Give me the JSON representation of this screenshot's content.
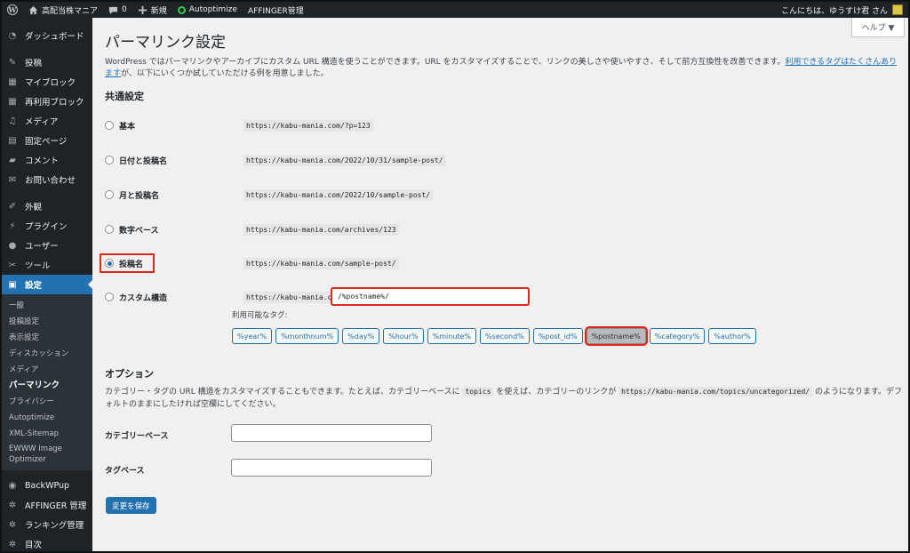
{
  "adminbar": {
    "site_name": "高配当株マニア",
    "comments_count": "0",
    "new_label": "新規",
    "autoptimize_label": "Autoptimize",
    "affinger_label": "AFFINGER管理",
    "greeting": "こんにちは、ゆうすけ君 さん",
    "status_color": "#2ecc40"
  },
  "sidebar": {
    "items": [
      {
        "label": "ダッシュボード",
        "icon": "dashboard-icon"
      },
      {
        "label": "投稿",
        "icon": "pin-icon"
      },
      {
        "label": "マイブロック",
        "icon": "grid-icon"
      },
      {
        "label": "再利用ブロック",
        "icon": "grid-icon"
      },
      {
        "label": "メディア",
        "icon": "media-icon"
      },
      {
        "label": "固定ページ",
        "icon": "page-icon"
      },
      {
        "label": "コメント",
        "icon": "comment-icon"
      },
      {
        "label": "お問い合わせ",
        "icon": "mail-icon"
      },
      {
        "label": "外観",
        "icon": "brush-icon"
      },
      {
        "label": "プラグイン",
        "icon": "plugin-icon"
      },
      {
        "label": "ユーザー",
        "icon": "user-icon"
      },
      {
        "label": "ツール",
        "icon": "wrench-icon"
      },
      {
        "label": "設定",
        "icon": "settings-icon"
      }
    ],
    "submenu": [
      "一般",
      "投稿設定",
      "表示設定",
      "ディスカッション",
      "メディア",
      "パーマリンク",
      "プライバシー",
      "Autoptimize",
      "XML-Sitemap",
      "EWWW Image Optimizer"
    ],
    "bottom_items": [
      {
        "label": "BackWPup",
        "icon": "backwpup-icon"
      },
      {
        "label": "AFFINGER 管理",
        "icon": "gear-icon"
      },
      {
        "label": "ランキング管理",
        "icon": "gear-icon"
      },
      {
        "label": "目次",
        "icon": "gear-icon"
      }
    ],
    "accent": "#2271b1"
  },
  "page": {
    "help_label": "ヘルプ ▼",
    "title": "パーマリンク設定",
    "intro_text": "WordPress ではパーマリンクやアーカイブにカスタム URL 構造を使うことができます。URL をカスタマイズすることで、リンクの美しさや使いやすさ、そして前方互換性を改善できます。",
    "intro_link": "利用できるタグはたくさんあります",
    "intro_tail": "が、以下にいくつか試していただける例を用意しました。",
    "common_heading": "共通設定",
    "options": [
      {
        "label": "基本",
        "example": "https://kabu-mania.com/?p=123",
        "checked": false
      },
      {
        "label": "日付と投稿名",
        "example": "https://kabu-mania.com/2022/10/31/sample-post/",
        "checked": false
      },
      {
        "label": "月と投稿名",
        "example": "https://kabu-mania.com/2022/10/sample-post/",
        "checked": false
      },
      {
        "label": "数字ベース",
        "example": "https://kabu-mania.com/archives/123",
        "checked": false
      },
      {
        "label": "投稿名",
        "example": "https://kabu-mania.com/sample-post/",
        "checked": true
      }
    ],
    "custom": {
      "label": "カスタム構造",
      "prefix": "https://kabu-mania.com",
      "value": "/%postname%/"
    },
    "available_tags_label": "利用可能なタグ:",
    "tags": [
      "%year%",
      "%monthnum%",
      "%day%",
      "%hour%",
      "%minute%",
      "%second%",
      "%post_id%",
      "%postname%",
      "%category%",
      "%author%"
    ],
    "active_tag": "%postname%",
    "options_heading": "オプション",
    "options_desc_1": "カテゴリー・タグの URL 構造をカスタマイズすることもできます。たとえば、カテゴリーベースに",
    "options_code_1": "topics",
    "options_desc_2": "を使えば、カテゴリーのリンクが",
    "options_code_2": "https://kabu-mania.com/topics/uncategorized/",
    "options_desc_3": "のようになります。デフォルトのままにしたければ空欄にしてください。",
    "category_base_label": "カテゴリーベース",
    "category_base_value": "",
    "tag_base_label": "タグベース",
    "tag_base_value": "",
    "save_label": "変更を保存",
    "highlight_color": "#e0281a"
  }
}
